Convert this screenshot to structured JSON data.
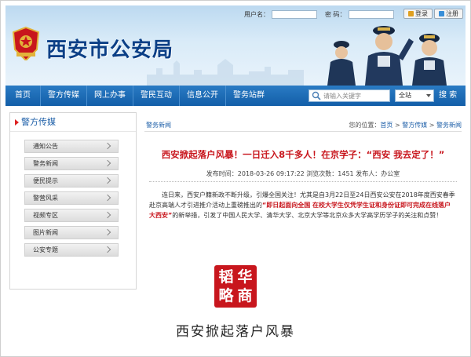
{
  "header": {
    "site_name": "西安市公安局",
    "login": {
      "username_label": "用户名：",
      "password_label": "密 码：",
      "login_button": "登录",
      "register_button": "注册"
    }
  },
  "nav": {
    "items": [
      "首页",
      "警方传媒",
      "网上办事",
      "警民互动",
      "信息公开",
      "警务站群"
    ],
    "search_placeholder": "请输入关键字",
    "search_scope": "全站",
    "search_button": "搜 索"
  },
  "sidebar": {
    "title": "警方传媒",
    "items": [
      "通知公告",
      "警务新闻",
      "便民提示",
      "警营风采",
      "视频专区",
      "图片新闻",
      "公安专题"
    ]
  },
  "article": {
    "section": "警务新闻",
    "breadcrumb_prefix": "您的位置：",
    "breadcrumb": [
      "首页",
      "警方传媒",
      "警务新闻"
    ],
    "breadcrumb_sep": " > ",
    "title": "西安掀起落户风暴！一日迁入8千多人！在京学子：“西安 我去定了！”",
    "meta": "发布时间：2018-03-26 09:17:22 浏览次数：1451 发布人：办公室",
    "body_pre": "连日来，西安户籍新政不断升级，引爆全国关注！尤其是自3月22日至24日西安公安在2018年度西安春季赴京高端人才引进推介活动上重磅推出的",
    "body_highlight": "“即日起面向全国 在校大学生仅凭学生证和身份证即可完成在线落户大西安”",
    "body_post": "的新举措，引发了中国人民大学、清华大学、北京大学等北京众多大学高学历学子的关注和点赞！"
  },
  "watermark": {
    "chars": [
      "韬",
      "华",
      "略",
      "商"
    ]
  },
  "caption": "西安掀起落户风暴",
  "colors": {
    "nav_blue": "#125ea8",
    "headline_red": "#c8161d",
    "link_blue": "#1d5fa8"
  }
}
